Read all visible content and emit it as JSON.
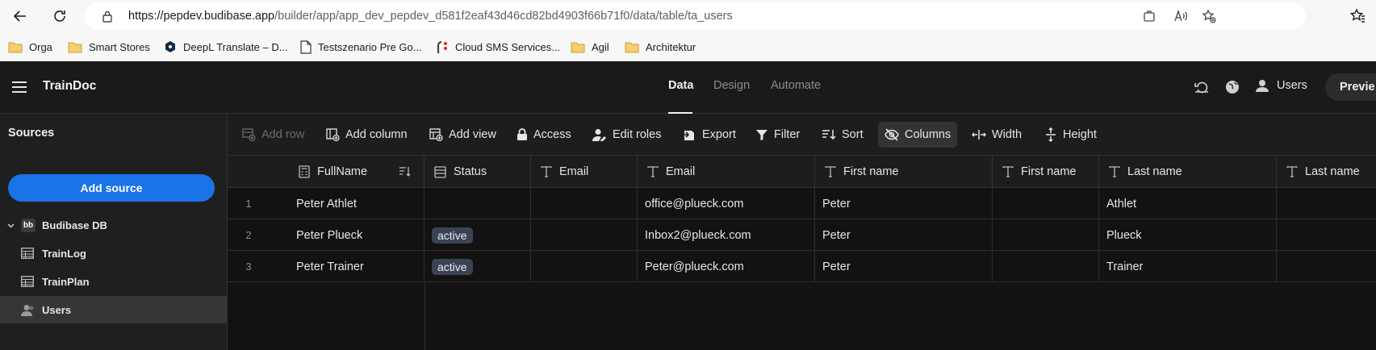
{
  "browser": {
    "url_host": "https://pepdev.budibase.app",
    "url_path": "/builder/app/app_dev_pepdev_d581f2eaf43d46cd82bd4903f66b71f0/data/table/ta_users",
    "bookmarks": [
      "Orga",
      "Smart Stores",
      "DeepL Translate – D...",
      "Testszenario Pre Go...",
      "Cloud SMS Services...",
      "Agil",
      "Architektur"
    ]
  },
  "app": {
    "name": "TrainDoc",
    "tabs": [
      "Data",
      "Design",
      "Automate"
    ],
    "users_label": "Users",
    "preview_label": "Previe"
  },
  "sidebar": {
    "title": "Sources",
    "add_source": "Add source",
    "db_name": "Budibase DB",
    "db_badge": "bb",
    "tables": [
      "TrainLog",
      "TrainPlan",
      "Users"
    ]
  },
  "toolbar": {
    "add_row": "Add row",
    "add_column": "Add column",
    "add_view": "Add view",
    "access": "Access",
    "edit_roles": "Edit roles",
    "export": "Export",
    "filter": "Filter",
    "sort": "Sort",
    "columns": "Columns",
    "width": "Width",
    "height": "Height"
  },
  "table": {
    "columns": [
      "FullName",
      "Status",
      "Email",
      "Email",
      "First name",
      "First name",
      "Last name",
      "Last name"
    ],
    "rows": [
      {
        "num": "1",
        "fullname": "Peter Athlet",
        "status": "",
        "email1": "",
        "email2": "office@plueck.com",
        "first1": "Peter",
        "first2": "",
        "last1": "Athlet",
        "last2": ""
      },
      {
        "num": "2",
        "fullname": "Peter Plueck",
        "status": "active",
        "email1": "",
        "email2": "Inbox2@plueck.com",
        "first1": "Peter",
        "first2": "",
        "last1": "Plueck",
        "last2": ""
      },
      {
        "num": "3",
        "fullname": "Peter Trainer",
        "status": "active",
        "email1": "",
        "email2": "Peter@plueck.com",
        "first1": "Peter",
        "first2": "",
        "last1": "Trainer",
        "last2": ""
      }
    ]
  },
  "colors": {
    "accent": "#1a73e8",
    "background": "#121212",
    "sidebar_selected": "#363636",
    "status_pill": "#3b4252"
  }
}
